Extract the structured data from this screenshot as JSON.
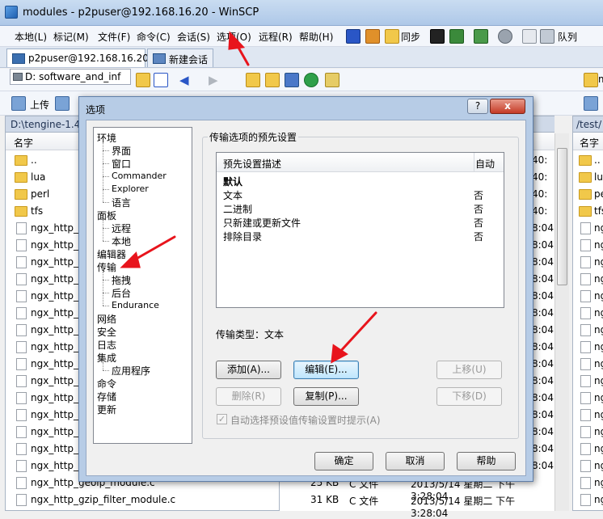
{
  "window": {
    "title": "modules - p2puser@192.168.16.20 - WinSCP"
  },
  "menu": [
    "本地(L)",
    "标记(M)",
    "文件(F)",
    "命令(C)",
    "会话(S)",
    "选项(O)",
    "远程(R)",
    "帮助(H)"
  ],
  "toolbar": {
    "sync_label": "同步",
    "queue_label": "队列",
    "upload_label": "上传"
  },
  "tabs": [
    {
      "label": "p2puser@192.168.16.20"
    },
    {
      "label": "新建会话"
    }
  ],
  "local": {
    "drive": "D: software_and_inf",
    "path": "D:\\tengine-1.4.",
    "column_name": "名字",
    "rows": [
      "..",
      "lua",
      "perl",
      "tfs",
      "ngx_http_ac",
      "ngx_http_ad",
      "ngx_http_au",
      "ngx_http_au",
      "ngx_http_br",
      "ngx_http_ch",
      "ngx_http_ch",
      "ngx_http_co",
      "ngx_http_da",
      "ngx_http_de",
      "ngx_http_em",
      "ngx_http_fas",
      "ngx_http_flv",
      "ngx_http_fo",
      "ngx_http_ge",
      "ngx_http_geoip_module.c",
      "ngx_http_gzip_filter_module.c"
    ],
    "row_sizes": {
      "19": "25 KB",
      "20": "31 KB"
    },
    "row_types": {
      "19": "C 文件",
      "20": "C 文件"
    },
    "row_dates": {
      "19": "2013/5/14 星期二 下午 3:28:04",
      "20": "2013/5/14 星期二 下午 3:28:04"
    },
    "partial_dates": [
      "40:",
      "40:",
      "40:",
      "40:",
      "8:04",
      "8:04",
      "8:04",
      "8:04",
      "8:04",
      "8:04",
      "8:04",
      "8:04",
      "8:04",
      "8:04",
      "8:04",
      "8:04",
      "8:04",
      "8:04",
      "8:04"
    ]
  },
  "remote": {
    "drive_partial": "m",
    "path": "/test/",
    "column_name": "名字",
    "rows": [
      "..",
      "lua",
      "pe",
      "tfs",
      "ng",
      "ng",
      "ng",
      "ng",
      "ng",
      "ng",
      "ng",
      "ng",
      "ng",
      "ng",
      "ng",
      "ng",
      "ng",
      "ng",
      "ng",
      "ng",
      "ng"
    ]
  },
  "dialog": {
    "title": "选项",
    "help_btn": "?",
    "close_btn": "x",
    "tree": [
      {
        "label": "环境",
        "level": 0
      },
      {
        "label": "界面",
        "level": 1
      },
      {
        "label": "窗口",
        "level": 1
      },
      {
        "label": "Commander",
        "level": 1
      },
      {
        "label": "Explorer",
        "level": 1
      },
      {
        "label": "语言",
        "level": 1
      },
      {
        "label": "面板",
        "level": 0
      },
      {
        "label": "远程",
        "level": 1
      },
      {
        "label": "本地",
        "level": 1
      },
      {
        "label": "编辑器",
        "level": 0
      },
      {
        "label": "传输",
        "level": 0
      },
      {
        "label": "拖拽",
        "level": 1
      },
      {
        "label": "后台",
        "level": 1
      },
      {
        "label": "Endurance",
        "level": 1
      },
      {
        "label": "网络",
        "level": 0
      },
      {
        "label": "安全",
        "level": 0
      },
      {
        "label": "日志",
        "level": 0
      },
      {
        "label": "集成",
        "level": 0
      },
      {
        "label": "应用程序",
        "level": 1
      },
      {
        "label": "命令",
        "level": 0
      },
      {
        "label": "存储",
        "level": 0
      },
      {
        "label": "更新",
        "level": 0
      }
    ],
    "group_title": "传输选项的预先设置",
    "list_headers": {
      "desc": "预先设置描述",
      "auto": "自动"
    },
    "presets": [
      {
        "desc": "默认",
        "auto": ""
      },
      {
        "desc": "文本",
        "auto": "否"
      },
      {
        "desc": "二进制",
        "auto": "否"
      },
      {
        "desc": "只新建或更新文件",
        "auto": "否"
      },
      {
        "desc": "排除目录",
        "auto": "否"
      }
    ],
    "transfer_type": "传输类型：文本",
    "buttons": {
      "add": "添加(A)...",
      "edit": "编辑(E)...",
      "up": "上移(U)",
      "delete": "删除(R)",
      "copy": "复制(P)...",
      "down": "下移(D)"
    },
    "auto_select_label": "自动选择预设值传输设置时提示(A)",
    "auto_select_checked": true,
    "footer": {
      "ok": "确定",
      "cancel": "取消",
      "help": "帮助"
    }
  },
  "colors": {
    "accent": "#3399ff",
    "annotation": "#e8141c"
  }
}
